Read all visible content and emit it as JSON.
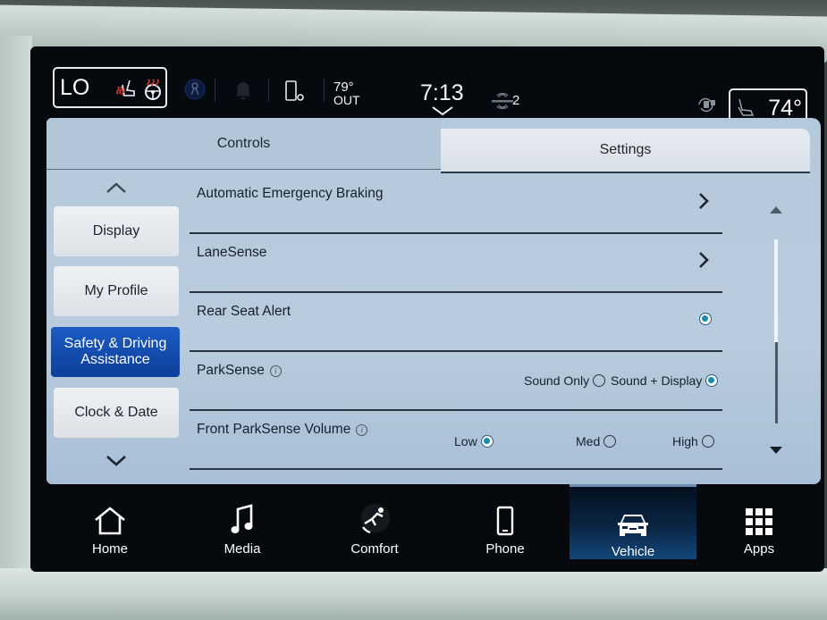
{
  "status_bar": {
    "driver_temp": "LO",
    "outside_temp": "79°",
    "outside_label": "OUT",
    "time": "7:13",
    "sirius_count": "2",
    "passenger_temp": "74°"
  },
  "tabs": [
    {
      "label": "Controls",
      "active": false
    },
    {
      "label": "Settings",
      "active": true
    }
  ],
  "side_nav": {
    "items": [
      {
        "label": "Display",
        "active": false
      },
      {
        "label": "My Profile",
        "active": false
      },
      {
        "label": "Safety & Driving Assistance",
        "active": true
      },
      {
        "label": "Clock & Date",
        "active": false
      }
    ]
  },
  "settings": {
    "rows": [
      {
        "title": "Automatic Emergency Braking",
        "control": "chevron"
      },
      {
        "title": "LaneSense",
        "control": "chevron"
      },
      {
        "title": "Rear Seat Alert",
        "control": "toggle",
        "checked": true
      },
      {
        "title": "ParkSense",
        "info": true,
        "control": "radio",
        "options": [
          {
            "label": "Sound Only",
            "selected": false
          },
          {
            "label": "Sound + Display",
            "selected": true
          }
        ]
      },
      {
        "title": "Front ParkSense Volume",
        "info": true,
        "control": "radio",
        "options": [
          {
            "label": "Low",
            "selected": true
          },
          {
            "label": "Med",
            "selected": false
          },
          {
            "label": "High",
            "selected": false
          }
        ]
      }
    ],
    "info_glyph": "i"
  },
  "scrollbar": {
    "position_fraction": 0.0,
    "visible_fraction": 0.56
  },
  "bottom_nav": {
    "items": [
      {
        "label": "Home",
        "icon": "home-icon",
        "active": false
      },
      {
        "label": "Media",
        "icon": "music-note-icon",
        "active": false
      },
      {
        "label": "Comfort",
        "icon": "comfort-seat-icon",
        "active": false
      },
      {
        "label": "Phone",
        "icon": "phone-icon",
        "active": false
      },
      {
        "label": "Vehicle",
        "icon": "car-icon",
        "active": true
      },
      {
        "label": "Apps",
        "icon": "apps-grid-icon",
        "active": false
      }
    ]
  },
  "colors": {
    "accent_blue": "#1c5cc4",
    "radio_selected": "#1a8bb0",
    "heat_red": "#d83a2e",
    "panel_bg": "#b9cbdc"
  }
}
